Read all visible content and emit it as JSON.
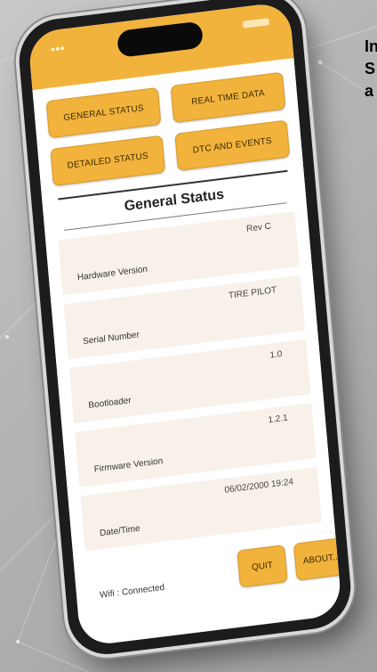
{
  "side_text": {
    "line1": "In",
    "line2": "S",
    "line3": "a"
  },
  "tabs": [
    {
      "label": "GENERAL STATUS"
    },
    {
      "label": "REAL TIME DATA"
    },
    {
      "label": "DETAILED STATUS"
    },
    {
      "label": "DTC AND EVENTS"
    }
  ],
  "section": {
    "title": "General Status"
  },
  "rows": [
    {
      "label": "Hardware Version",
      "value": "Rev C"
    },
    {
      "label": "Serial Number",
      "value": "TIRE PILOT"
    },
    {
      "label": "Bootloader",
      "value": "1.0"
    },
    {
      "label": "Firmware Version",
      "value": "1.2.1"
    },
    {
      "label": "Date/Time",
      "value": "06/02/2000 19:24"
    }
  ],
  "footer": {
    "wifi_status": "Wifi : Connected",
    "quit_label": "QUIT",
    "about_label": "ABOUT..."
  },
  "colors": {
    "accent": "#f2b33d",
    "row_bg": "#f7f1ea"
  }
}
